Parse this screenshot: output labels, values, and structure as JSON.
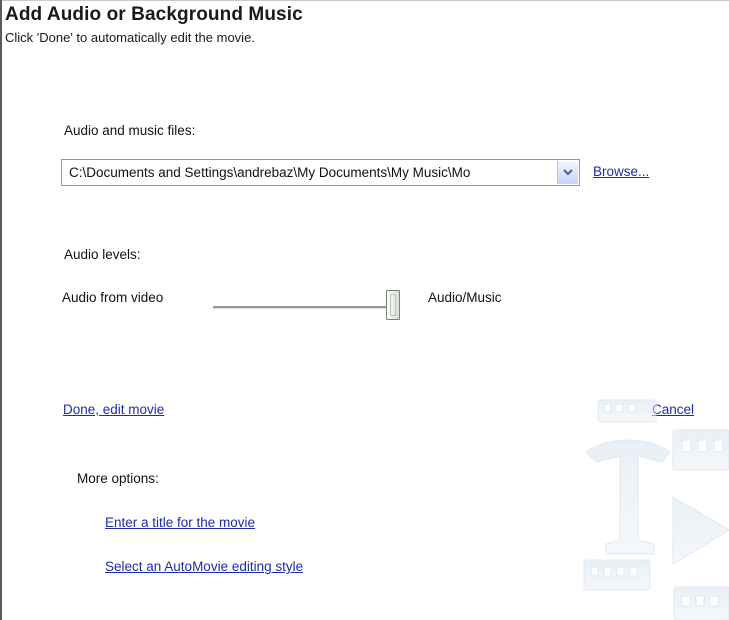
{
  "header": {
    "title": "Add Audio or Background Music",
    "subtitle": "Click 'Done' to automatically edit the movie."
  },
  "audio_files": {
    "label": "Audio and music files:",
    "selected_value": "C:\\Documents and Settings\\andrebaz\\My Documents\\My Music\\Mo",
    "browse_label": "Browse..."
  },
  "audio_levels": {
    "label": "Audio levels:",
    "left_label": "Audio from video",
    "right_label": "Audio/Music",
    "slider_position": 1.0
  },
  "actions": {
    "done_label": "Done, edit movie",
    "cancel_label": "Cancel"
  },
  "more_options": {
    "label": "More options:",
    "links": [
      "Enter a title for the movie",
      "Select an AutoMovie editing style"
    ]
  },
  "colors": {
    "link": "#1c2ea8",
    "combo_border": "#7f9db9"
  }
}
